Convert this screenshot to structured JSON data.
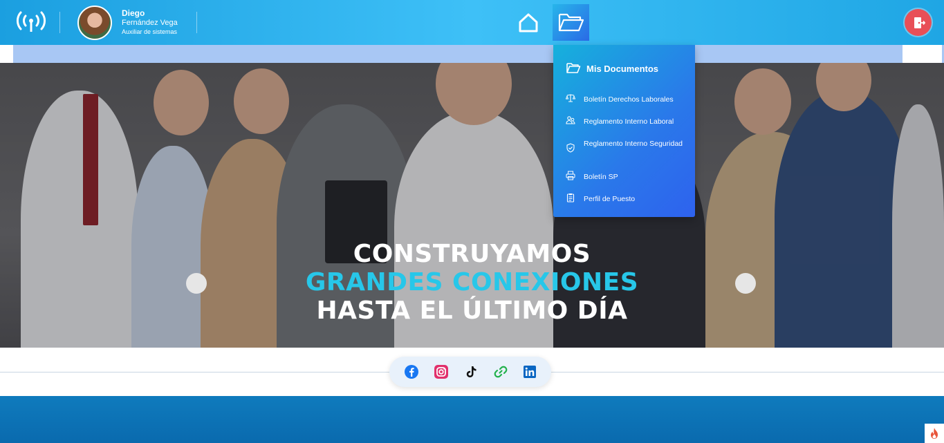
{
  "user": {
    "first_name": "Diego",
    "last_name": "Fernández Vega",
    "role": "Auxiliar de sistemas"
  },
  "nav": {
    "home_icon": "home-icon",
    "documents_icon": "folder-icon",
    "logout_icon": "logout-icon",
    "signal_icon": "antenna-icon"
  },
  "dropdown": {
    "title": "Mis Documentos",
    "items": [
      {
        "label": "Boletín Derechos Laborales",
        "icon": "scale-icon"
      },
      {
        "label": "Reglamento Interno Laboral",
        "icon": "people-icon"
      },
      {
        "label": "Reglamento Interno Seguridad",
        "icon": "shield-icon"
      },
      {
        "label": "Boletín SP",
        "icon": "printer-icon"
      },
      {
        "label": "Perfil de Puesto",
        "icon": "clipboard-icon"
      }
    ]
  },
  "hero": {
    "line1": "CONSTRUYAMOS",
    "line2": "GRANDES CONEXIONES",
    "line3": "HASTA EL ÚLTIMO DÍA"
  },
  "social": [
    "facebook-icon",
    "instagram-icon",
    "tiktok-icon",
    "link-icon",
    "linkedin-icon"
  ],
  "colors": {
    "topbar": "#3ec0f7",
    "accent": "#27c7e9",
    "logout": "#e84f57",
    "bottom": "#0f7bbd"
  }
}
